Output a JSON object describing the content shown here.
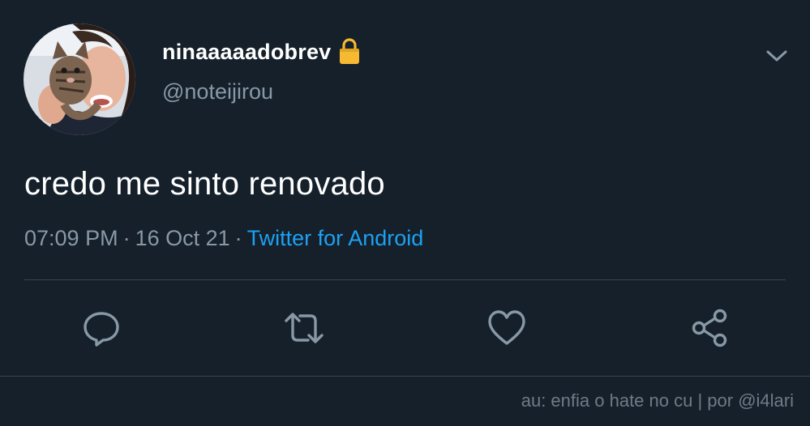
{
  "tweet": {
    "display_name": "ninaaaaadobrev",
    "handle": "@noteijirou",
    "text": "credo me sinto renovado",
    "time": "07:09 PM",
    "date": "16 Oct 21",
    "separator": "·",
    "source": "Twitter for Android",
    "protected_icon": "lock-icon",
    "menu_icon": "chevron-down-icon"
  },
  "actions": [
    {
      "icon": "reply-icon"
    },
    {
      "icon": "retweet-icon"
    },
    {
      "icon": "like-icon"
    },
    {
      "icon": "share-icon"
    }
  ],
  "footer": {
    "credit": "au: enfia o hate no cu | por @i4lari"
  },
  "colors": {
    "background": "#15202b",
    "primary_text": "#ffffff",
    "secondary_text": "#8899a6",
    "accent": "#1da1f2",
    "divider": "#38444d",
    "lock": "#f5b932"
  }
}
